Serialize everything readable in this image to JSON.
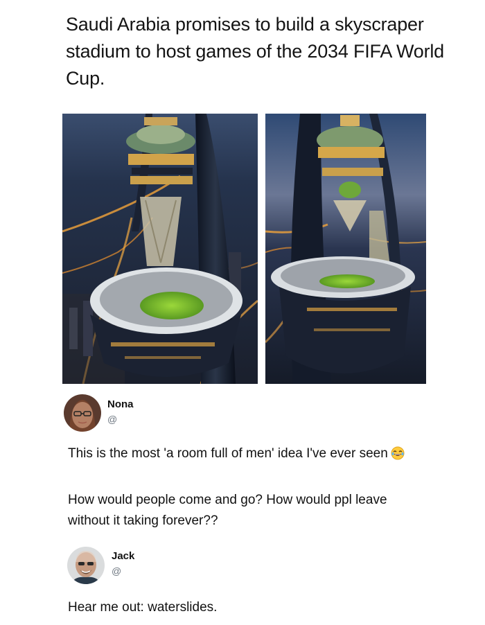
{
  "post": {
    "headline": "Saudi Arabia promises to build a skyscraper stadium to host games of the 2034 FIFA World Cup."
  },
  "colors": {
    "night_sky": "#1d2b44",
    "city_lights": "#f0a040",
    "pitch_green": "#7cc22e",
    "tower_dark": "#141b2a",
    "handle_gray": "#6e7781"
  },
  "tweets": [
    {
      "name": "Nona",
      "handle": "@",
      "paragraphs": [
        "This is the most 'a room full of men' idea I've ever seen",
        "How would people come and go? How would ppl leave without it taking forever??"
      ],
      "emoji_icon": "rolling-on-floor-laughing-emoji"
    },
    {
      "name": "Jack",
      "handle": "@",
      "paragraphs": [
        "Hear me out: waterslides."
      ]
    }
  ]
}
